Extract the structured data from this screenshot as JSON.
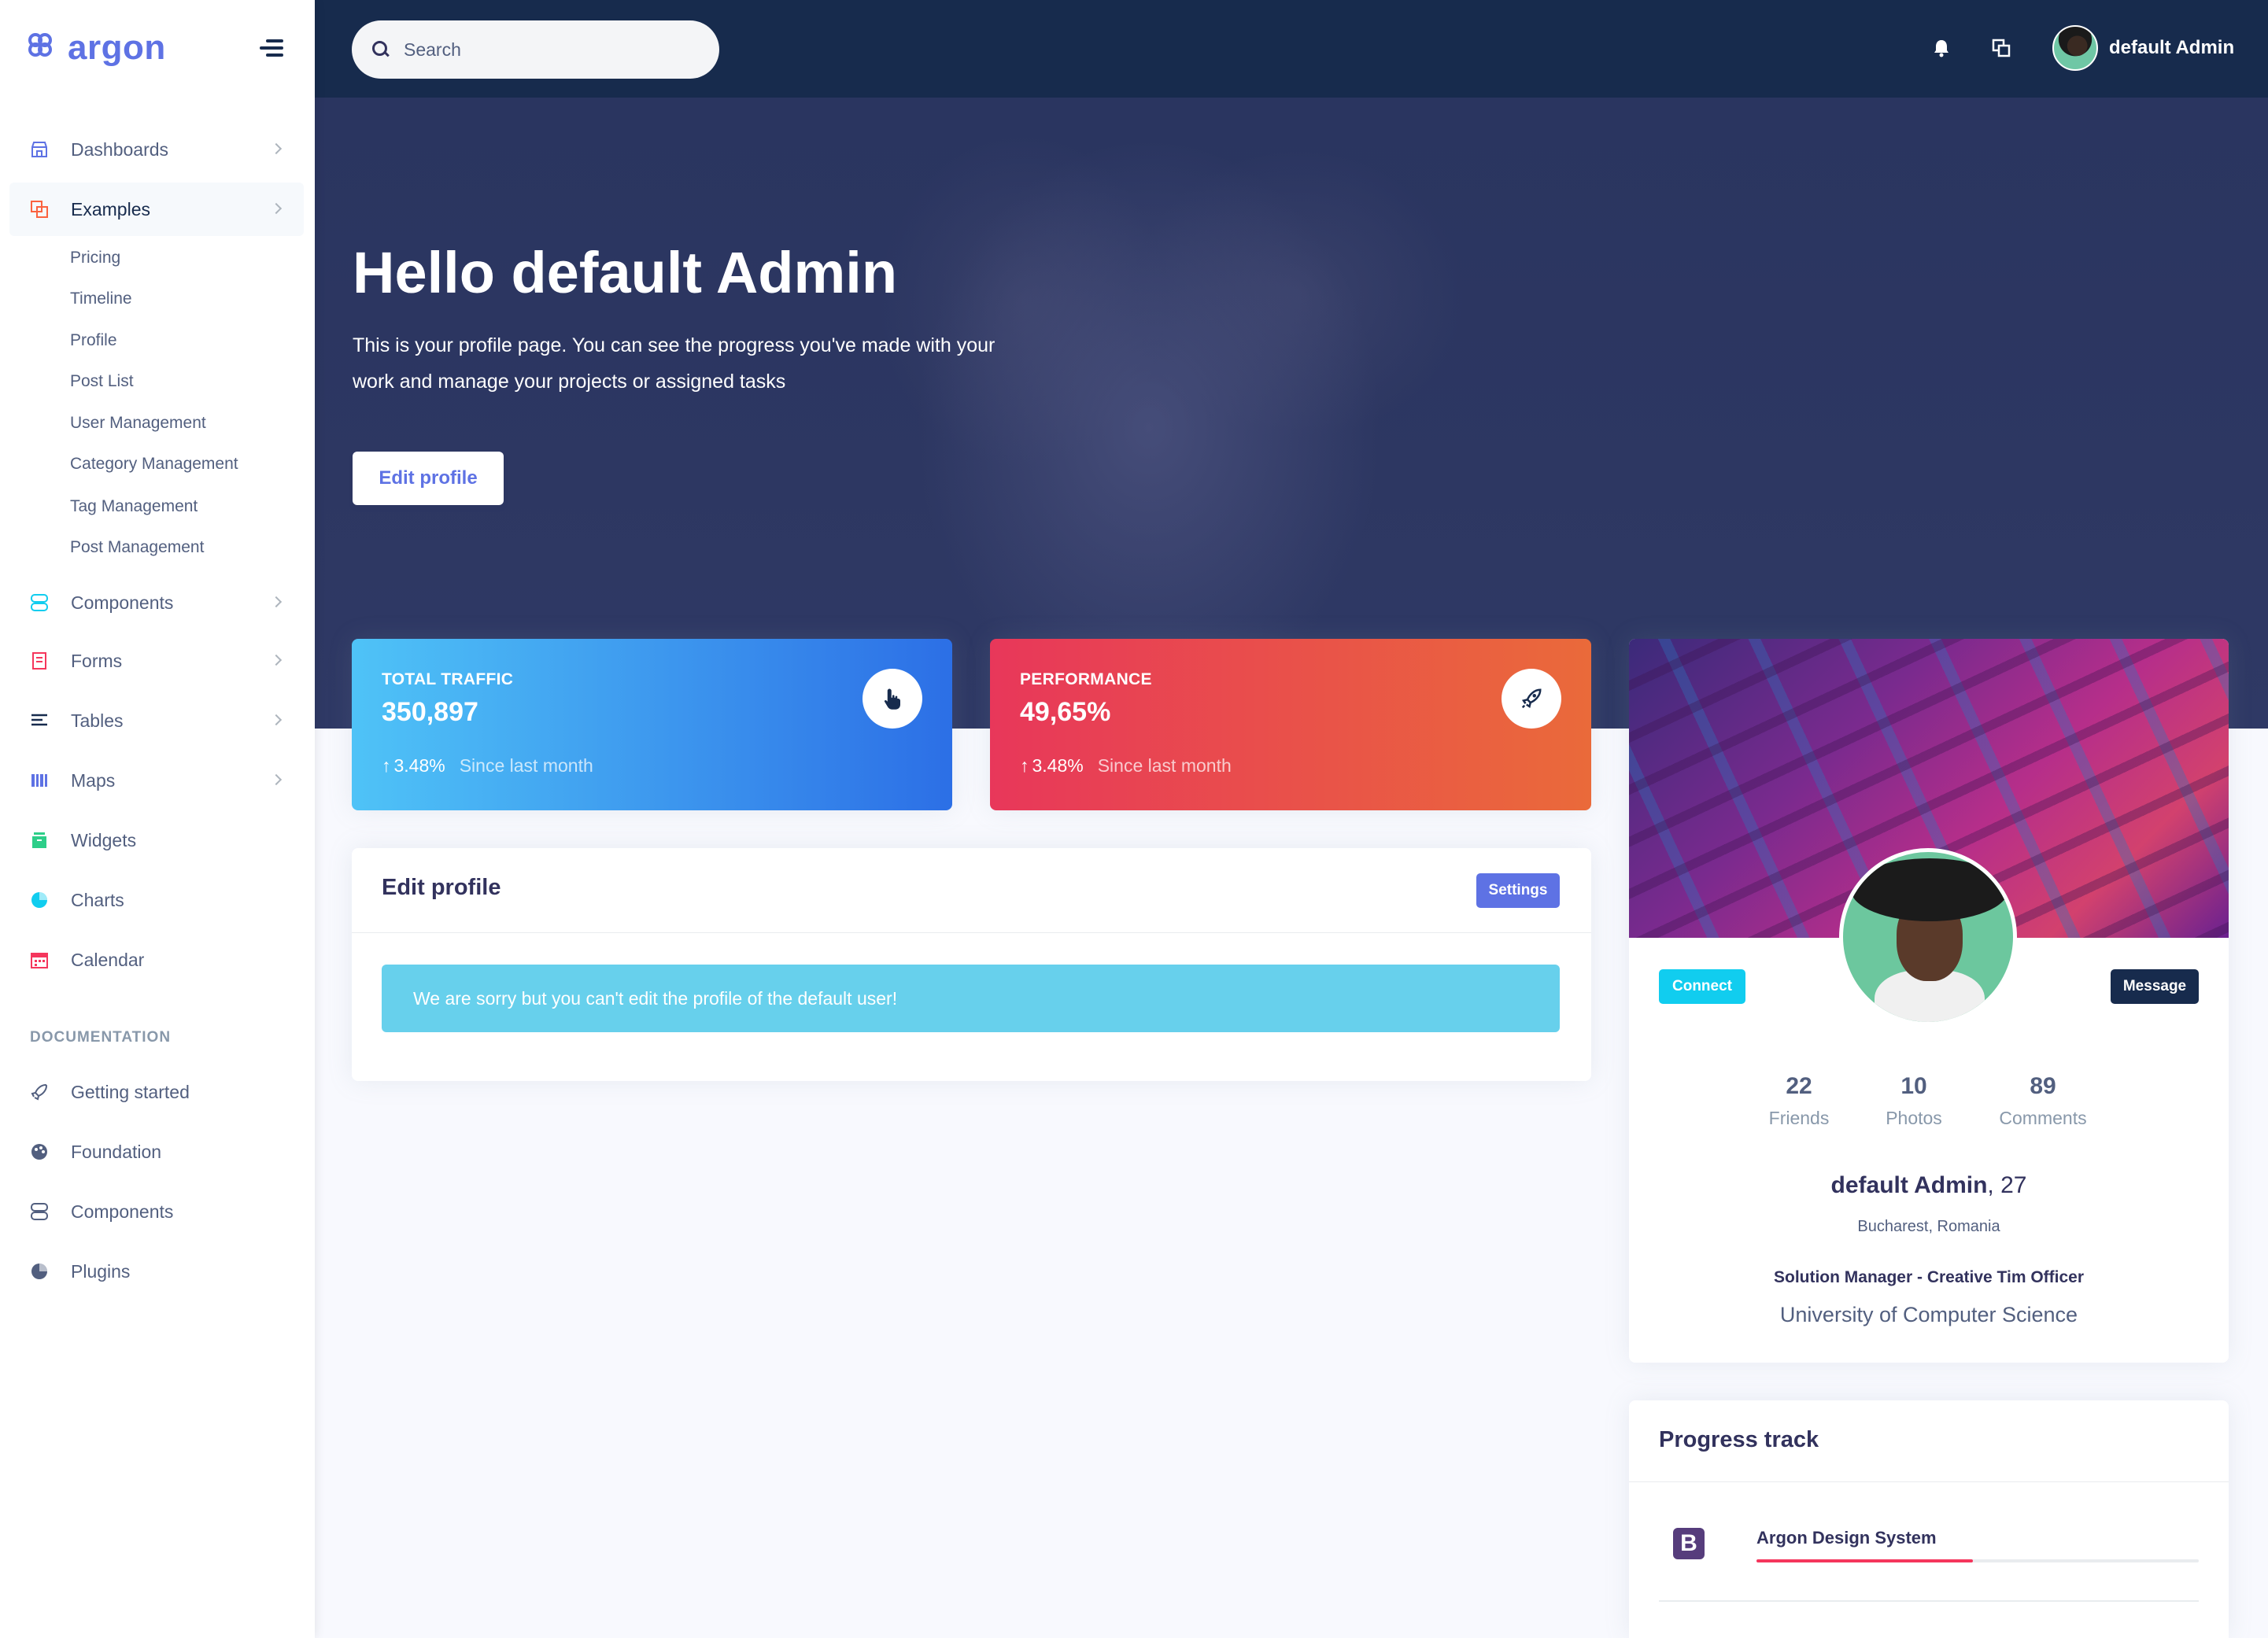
{
  "sidebar": {
    "brand": "argon",
    "nav": [
      {
        "label": "Dashboards",
        "icon": "shop-icon",
        "color": "#5e72e4"
      },
      {
        "label": "Examples",
        "icon": "ungroup-icon",
        "color": "#fb6340"
      },
      {
        "label": "Components",
        "icon": "ui-04-icon",
        "color": "#11cdef"
      },
      {
        "label": "Forms",
        "icon": "single-copy-icon",
        "color": "#f5365c"
      },
      {
        "label": "Tables",
        "icon": "align-left-icon",
        "color": "#172b4d"
      },
      {
        "label": "Maps",
        "icon": "map-big-icon",
        "color": "#5e72e4"
      },
      {
        "label": "Widgets",
        "icon": "archive-icon",
        "color": "#2dce89"
      },
      {
        "label": "Charts",
        "icon": "chart-pie-icon",
        "color": "#11cdef"
      },
      {
        "label": "Calendar",
        "icon": "calendar-icon",
        "color": "#f5365c"
      }
    ],
    "examples_sub": [
      "Pricing",
      "Timeline",
      "Profile",
      "Post List",
      "User Management",
      "Category Management",
      "Tag Management",
      "Post Management"
    ],
    "doc_heading": "DOCUMENTATION",
    "docs": [
      {
        "label": "Getting started",
        "icon": "spaceship-icon"
      },
      {
        "label": "Foundation",
        "icon": "palette-icon"
      },
      {
        "label": "Components",
        "icon": "ui-04-icon"
      },
      {
        "label": "Plugins",
        "icon": "chart-pie-icon"
      }
    ]
  },
  "topnav": {
    "search_placeholder": "Search",
    "user_name": "default Admin"
  },
  "hero": {
    "title": "Hello default Admin",
    "text": "This is your profile page. You can see the progress you've made with your work and manage your projects or assigned tasks",
    "button": "Edit profile"
  },
  "stats": [
    {
      "title": "TOTAL TRAFFIC",
      "value": "350,897",
      "change": "3.48%",
      "since": "Since last month",
      "icon": "pointer-icon",
      "gradient": [
        "#4fc3f7",
        "#2c6fe6"
      ]
    },
    {
      "title": "PERFORMANCE",
      "value": "49,65%",
      "change": "3.48%",
      "since": "Since last month",
      "icon": "rocket-icon",
      "gradient": [
        "#e8375a",
        "#ea6a3a"
      ]
    }
  ],
  "edit_profile": {
    "title": "Edit profile",
    "settings_label": "Settings",
    "alert": "We are sorry but you can't edit the profile of the default user!"
  },
  "profile": {
    "connect_label": "Connect",
    "message_label": "Message",
    "stats": [
      {
        "value": "22",
        "label": "Friends"
      },
      {
        "value": "10",
        "label": "Photos"
      },
      {
        "value": "89",
        "label": "Comments"
      }
    ],
    "name": "default Admin",
    "age": ", 27",
    "location": "Bucharest, Romania",
    "job": "Solution Manager - Creative Tim Officer",
    "school": "University of Computer Science"
  },
  "progress_track": {
    "title": "Progress track",
    "items": [
      {
        "name": "Argon Design System",
        "logo": "B",
        "progress": 0.49
      }
    ]
  }
}
